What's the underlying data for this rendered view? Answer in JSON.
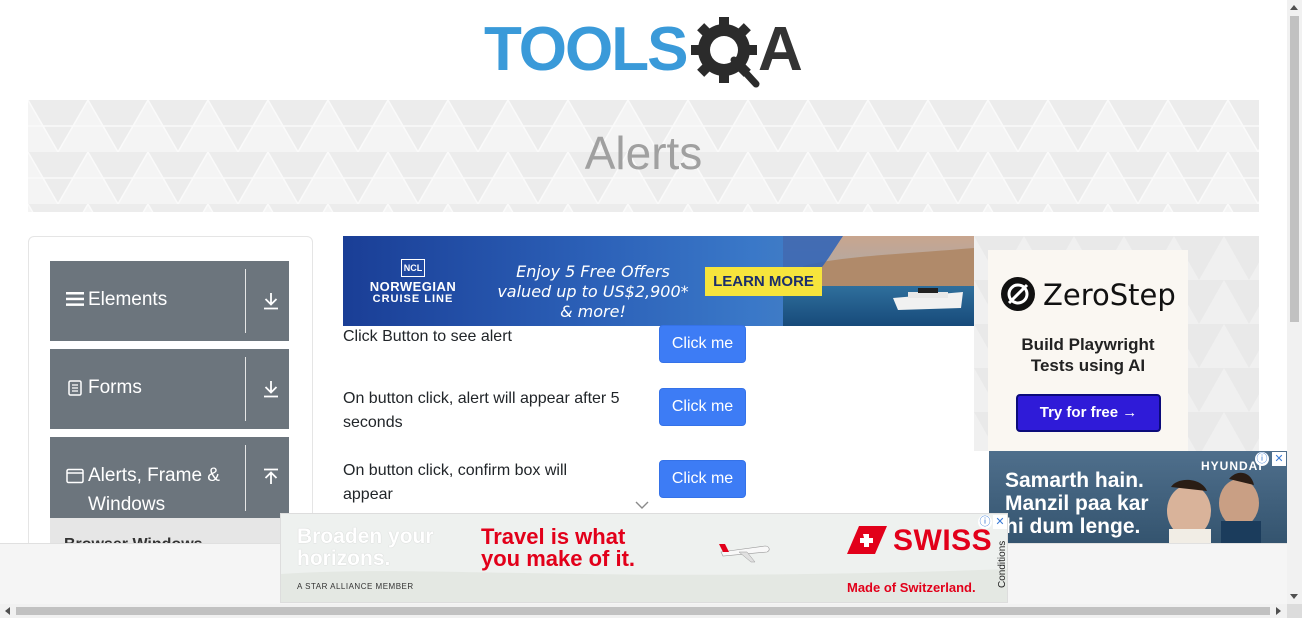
{
  "header": {
    "logo_tools": "TOOLS",
    "logo_qa": "A"
  },
  "banner": {
    "title": "Alerts"
  },
  "sidebar": {
    "groups": [
      {
        "label": "Elements",
        "icon": "hamburger-icon",
        "state": "collapsed"
      },
      {
        "label": "Forms",
        "icon": "document-icon",
        "state": "collapsed"
      },
      {
        "label_line1": "Alerts, Frame &",
        "label_line2": "Windows",
        "icon": "window-icon",
        "state": "expanded"
      }
    ],
    "sub_item_partial": "Browser Windows"
  },
  "alerts": [
    {
      "text": "Click Button to see alert",
      "button": "Click me"
    },
    {
      "text": "On button click, alert will appear after 5 seconds",
      "button": "Click me"
    },
    {
      "text": "On button click, confirm box will appear",
      "button": "Click me"
    }
  ],
  "ads": {
    "ncl": {
      "badge": "NCL",
      "name_line1": "NORWEGIAN",
      "name_line2": "CRUISE LINE",
      "offer": "Enjoy 5 Free Offers valued up to US$2,900* & more!",
      "cta": "LEARN MORE"
    },
    "zerostep": {
      "name": "ZeroStep",
      "tagline_line1": "Build Playwright",
      "tagline_line2": "Tests using AI",
      "cta": "Try for free →"
    },
    "hyundai": {
      "brand": "HYUNDAI",
      "line1": "Samarth hain.",
      "line2": "Manzil paa kar",
      "line3": "hi dum lenge."
    },
    "swiss": {
      "left_line1": "Broaden your",
      "left_line2": "horizons.",
      "member": "A STAR ALLIANCE MEMBER",
      "mid_line1": "Travel is what",
      "mid_line2": "you make of it.",
      "brand": "SWISS",
      "made": "Made of Switzerland.",
      "conditions": "Conditions"
    }
  },
  "colors": {
    "sidebar_group": "#6c757d",
    "primary_button": "#3d7cf5",
    "logo_blue": "#3a9ad9",
    "logo_dark": "#333333"
  }
}
